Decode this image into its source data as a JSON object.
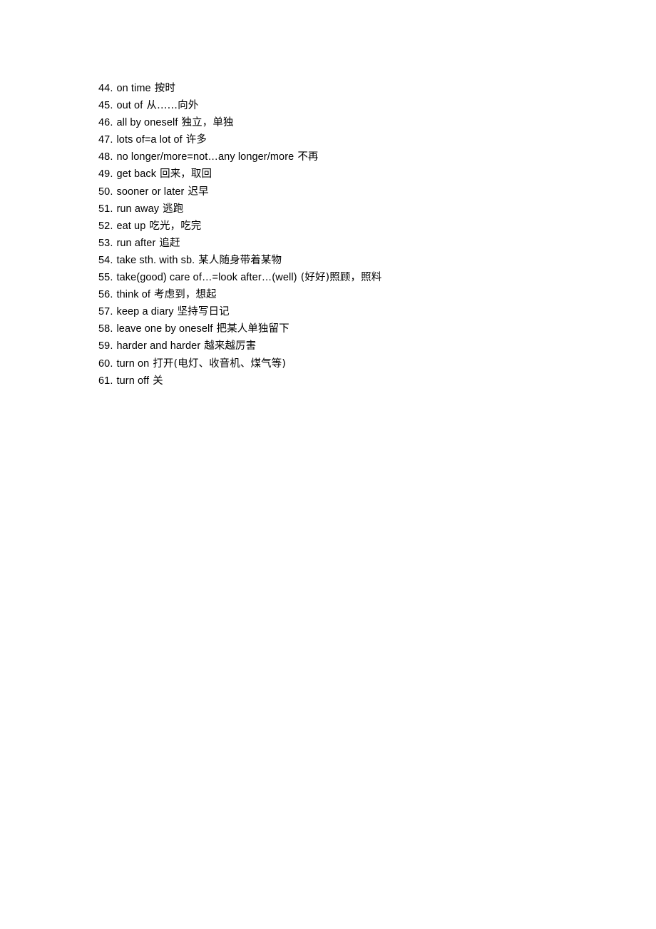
{
  "document": {
    "background_color": "#ffffff",
    "text_color": "#000000",
    "items": [
      {
        "num": "44.",
        "en": "on time",
        "zh": "按时"
      },
      {
        "num": "45.",
        "en": "out of",
        "zh": "从……向外"
      },
      {
        "num": "46.",
        "en": "all by oneself",
        "zh": "独立，单独"
      },
      {
        "num": "47.",
        "en": "lots of=a lot of",
        "zh": "许多"
      },
      {
        "num": "48.",
        "en": "no longer/more=not…any longer/more",
        "zh": "不再"
      },
      {
        "num": "49.",
        "en": "get back",
        "zh": "回来，取回"
      },
      {
        "num": "50.",
        "en": "sooner or later",
        "zh": "迟早"
      },
      {
        "num": "51.",
        "en": "run away",
        "zh": "逃跑"
      },
      {
        "num": "52.",
        "en": "eat up",
        "zh": "吃光，吃完"
      },
      {
        "num": "53.",
        "en": "run after",
        "zh": "追赶"
      },
      {
        "num": "54.",
        "en": "take sth. with sb.",
        "zh": "某人随身带着某物"
      },
      {
        "num": "55.",
        "en": "take(good) care of…=look after…(well)",
        "zh": "(好好)照顾，照料"
      },
      {
        "num": "56.",
        "en": "think of",
        "zh": "考虑到，想起"
      },
      {
        "num": "57.",
        "en": "keep a diary",
        "zh": "坚持写日记"
      },
      {
        "num": "58.",
        "en": "leave one by oneself",
        "zh": "把某人单独留下"
      },
      {
        "num": "59.",
        "en": "harder and harder",
        "zh": "越来越厉害"
      },
      {
        "num": "60.",
        "en": "turn on",
        "zh": "打开(电灯、收音机、煤气等)"
      },
      {
        "num": "61.",
        "en": "turn off",
        "zh": "关"
      }
    ]
  }
}
